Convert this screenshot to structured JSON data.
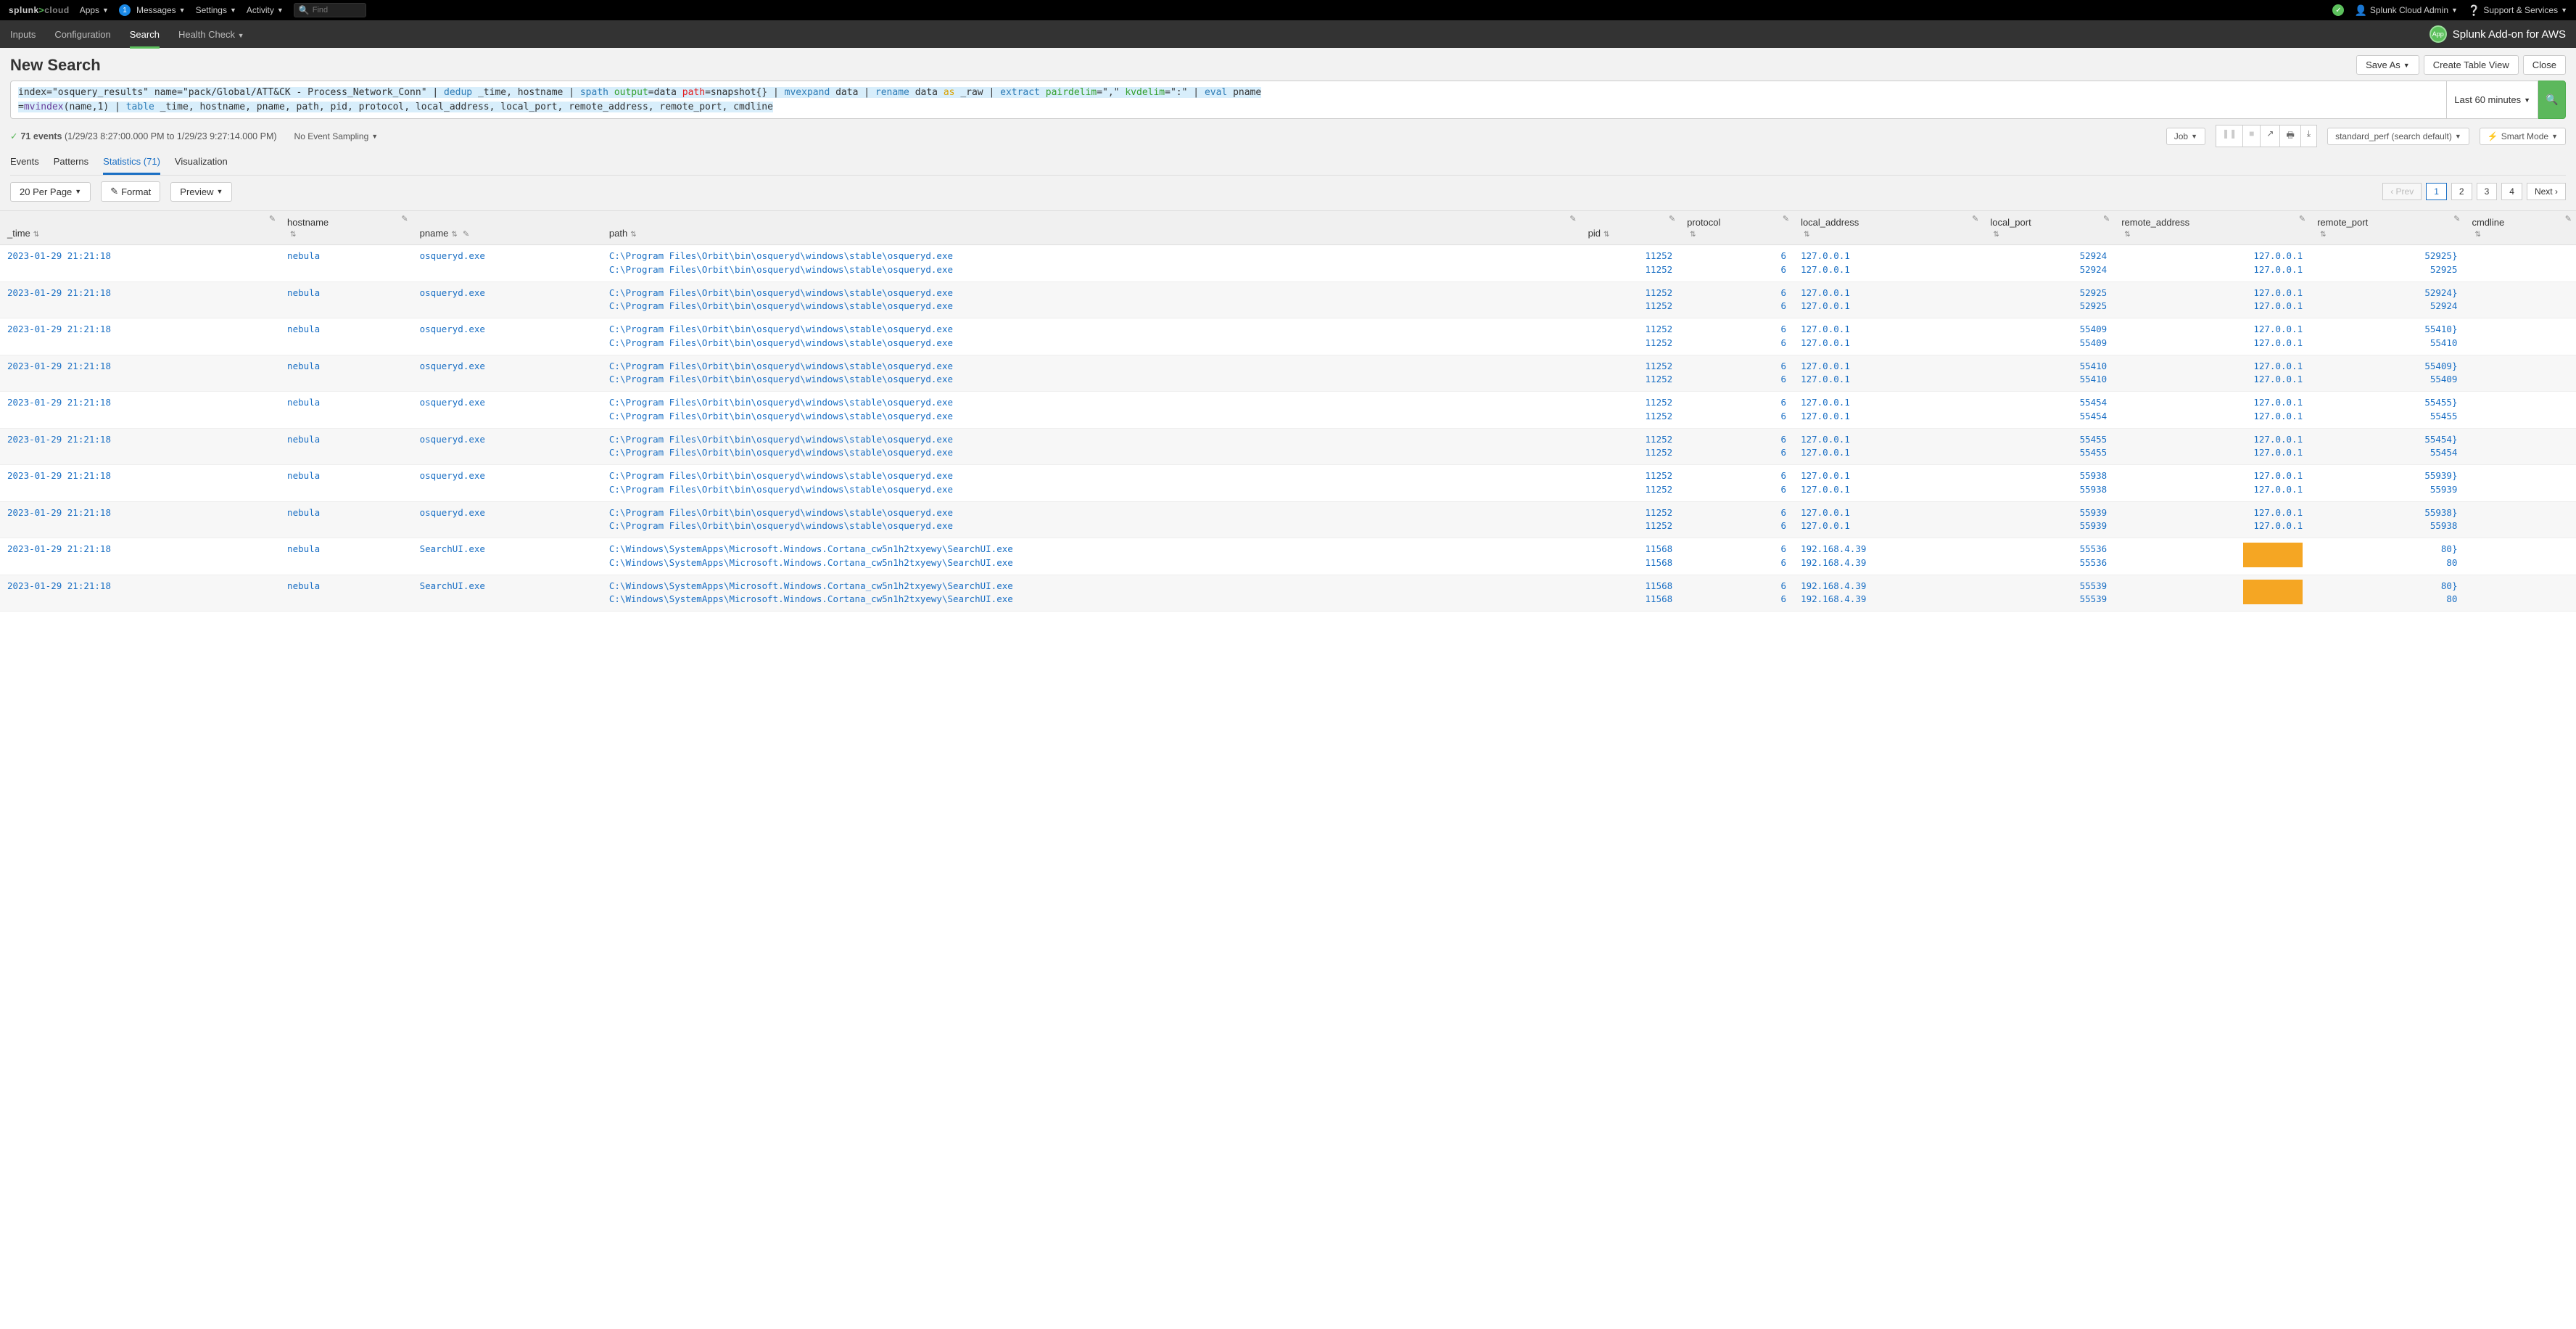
{
  "topbar": {
    "brand_prefix": "splunk",
    "brand_suffix": "cloud",
    "apps": "Apps",
    "messages": "Messages",
    "messages_badge": "1",
    "settings": "Settings",
    "activity": "Activity",
    "find_placeholder": "Find",
    "user": "Splunk Cloud Admin",
    "support": "Support & Services"
  },
  "secondbar": {
    "inputs": "Inputs",
    "configuration": "Configuration",
    "search": "Search",
    "healthcheck": "Health Check",
    "appbadge": "App",
    "appname": "Splunk Add-on for AWS"
  },
  "title": "New Search",
  "buttons": {
    "saveas": "Save As",
    "create_table": "Create Table View",
    "close": "Close",
    "timepicker": "Last 60 minutes",
    "perpage": "20 Per Page",
    "format": "Format",
    "preview": "Preview"
  },
  "spl": {
    "l1a": "index=\"osquery_results\" name=\"pack/Global/ATT&CK - Process_Network_Conn\" | ",
    "dedup": "dedup",
    "l1b": " _time, hostname | ",
    "spath": "spath",
    "output": " output",
    "l1c": "=data ",
    "path": "path",
    "l1d": "=snapshot{} | ",
    "mvexpand": "mvexpand",
    "l1e": " data | ",
    "rename": "rename",
    "l1f": " data ",
    "as": "as",
    "l1g": " _raw | ",
    "extract": "extract",
    "pairdelim": " pairdelim",
    "l1h": "=\",\" ",
    "kvdelim": "kvdelim",
    "l1i": "=\":\" | ",
    "eval": "eval",
    "l1j": " pname",
    "l2a": "    =",
    "mvindex": "mvindex",
    "l2b": "(name,1) | ",
    "table": "table",
    "l2c": " _time, hostname, pname, path, pid, protocol, local_address, local_port, remote_address, remote_port, cmdline"
  },
  "status": {
    "events": "71 events",
    "range": "(1/29/23 8:27:00.000 PM to 1/29/23 9:27:14.000 PM)",
    "sampling": "No Event Sampling",
    "job": "Job",
    "mode": "standard_perf (search default)",
    "smart": "Smart Mode"
  },
  "tabs": {
    "events": "Events",
    "patterns": "Patterns",
    "stats": "Statistics (71)",
    "viz": "Visualization"
  },
  "pager": {
    "prev": "Prev",
    "next": "Next",
    "p1": "1",
    "p2": "2",
    "p3": "3",
    "p4": "4"
  },
  "cols": {
    "time": "_time",
    "hostname": "hostname",
    "pname": "pname",
    "path": "path",
    "pid": "pid",
    "protocol": "protocol",
    "local_address": "local_address",
    "local_port": "local_port",
    "remote_address": "remote_address",
    "remote_port": "remote_port",
    "cmdline": "cmdline"
  },
  "rows": [
    {
      "time": "2023-01-29 21:21:18",
      "host": "nebula",
      "pname": "osqueryd.exe",
      "path": [
        "C:\\Program Files\\Orbit\\bin\\osqueryd\\windows\\stable\\osqueryd.exe",
        "C:\\Program Files\\Orbit\\bin\\osqueryd\\windows\\stable\\osqueryd.exe"
      ],
      "pid": [
        "11252",
        "11252"
      ],
      "proto": [
        "6",
        "6"
      ],
      "laddr": [
        "127.0.0.1",
        "127.0.0.1"
      ],
      "lport": [
        "52924",
        "52924"
      ],
      "raddr": [
        "127.0.0.1",
        "127.0.0.1"
      ],
      "rport": [
        "52925}",
        "52925"
      ]
    },
    {
      "time": "2023-01-29 21:21:18",
      "host": "nebula",
      "pname": "osqueryd.exe",
      "path": [
        "C:\\Program Files\\Orbit\\bin\\osqueryd\\windows\\stable\\osqueryd.exe",
        "C:\\Program Files\\Orbit\\bin\\osqueryd\\windows\\stable\\osqueryd.exe"
      ],
      "pid": [
        "11252",
        "11252"
      ],
      "proto": [
        "6",
        "6"
      ],
      "laddr": [
        "127.0.0.1",
        "127.0.0.1"
      ],
      "lport": [
        "52925",
        "52925"
      ],
      "raddr": [
        "127.0.0.1",
        "127.0.0.1"
      ],
      "rport": [
        "52924}",
        "52924"
      ]
    },
    {
      "time": "2023-01-29 21:21:18",
      "host": "nebula",
      "pname": "osqueryd.exe",
      "path": [
        "C:\\Program Files\\Orbit\\bin\\osqueryd\\windows\\stable\\osqueryd.exe",
        "C:\\Program Files\\Orbit\\bin\\osqueryd\\windows\\stable\\osqueryd.exe"
      ],
      "pid": [
        "11252",
        "11252"
      ],
      "proto": [
        "6",
        "6"
      ],
      "laddr": [
        "127.0.0.1",
        "127.0.0.1"
      ],
      "lport": [
        "55409",
        "55409"
      ],
      "raddr": [
        "127.0.0.1",
        "127.0.0.1"
      ],
      "rport": [
        "55410}",
        "55410"
      ]
    },
    {
      "time": "2023-01-29 21:21:18",
      "host": "nebula",
      "pname": "osqueryd.exe",
      "path": [
        "C:\\Program Files\\Orbit\\bin\\osqueryd\\windows\\stable\\osqueryd.exe",
        "C:\\Program Files\\Orbit\\bin\\osqueryd\\windows\\stable\\osqueryd.exe"
      ],
      "pid": [
        "11252",
        "11252"
      ],
      "proto": [
        "6",
        "6"
      ],
      "laddr": [
        "127.0.0.1",
        "127.0.0.1"
      ],
      "lport": [
        "55410",
        "55410"
      ],
      "raddr": [
        "127.0.0.1",
        "127.0.0.1"
      ],
      "rport": [
        "55409}",
        "55409"
      ]
    },
    {
      "time": "2023-01-29 21:21:18",
      "host": "nebula",
      "pname": "osqueryd.exe",
      "path": [
        "C:\\Program Files\\Orbit\\bin\\osqueryd\\windows\\stable\\osqueryd.exe",
        "C:\\Program Files\\Orbit\\bin\\osqueryd\\windows\\stable\\osqueryd.exe"
      ],
      "pid": [
        "11252",
        "11252"
      ],
      "proto": [
        "6",
        "6"
      ],
      "laddr": [
        "127.0.0.1",
        "127.0.0.1"
      ],
      "lport": [
        "55454",
        "55454"
      ],
      "raddr": [
        "127.0.0.1",
        "127.0.0.1"
      ],
      "rport": [
        "55455}",
        "55455"
      ]
    },
    {
      "time": "2023-01-29 21:21:18",
      "host": "nebula",
      "pname": "osqueryd.exe",
      "path": [
        "C:\\Program Files\\Orbit\\bin\\osqueryd\\windows\\stable\\osqueryd.exe",
        "C:\\Program Files\\Orbit\\bin\\osqueryd\\windows\\stable\\osqueryd.exe"
      ],
      "pid": [
        "11252",
        "11252"
      ],
      "proto": [
        "6",
        "6"
      ],
      "laddr": [
        "127.0.0.1",
        "127.0.0.1"
      ],
      "lport": [
        "55455",
        "55455"
      ],
      "raddr": [
        "127.0.0.1",
        "127.0.0.1"
      ],
      "rport": [
        "55454}",
        "55454"
      ]
    },
    {
      "time": "2023-01-29 21:21:18",
      "host": "nebula",
      "pname": "osqueryd.exe",
      "path": [
        "C:\\Program Files\\Orbit\\bin\\osqueryd\\windows\\stable\\osqueryd.exe",
        "C:\\Program Files\\Orbit\\bin\\osqueryd\\windows\\stable\\osqueryd.exe"
      ],
      "pid": [
        "11252",
        "11252"
      ],
      "proto": [
        "6",
        "6"
      ],
      "laddr": [
        "127.0.0.1",
        "127.0.0.1"
      ],
      "lport": [
        "55938",
        "55938"
      ],
      "raddr": [
        "127.0.0.1",
        "127.0.0.1"
      ],
      "rport": [
        "55939}",
        "55939"
      ]
    },
    {
      "time": "2023-01-29 21:21:18",
      "host": "nebula",
      "pname": "osqueryd.exe",
      "path": [
        "C:\\Program Files\\Orbit\\bin\\osqueryd\\windows\\stable\\osqueryd.exe",
        "C:\\Program Files\\Orbit\\bin\\osqueryd\\windows\\stable\\osqueryd.exe"
      ],
      "pid": [
        "11252",
        "11252"
      ],
      "proto": [
        "6",
        "6"
      ],
      "laddr": [
        "127.0.0.1",
        "127.0.0.1"
      ],
      "lport": [
        "55939",
        "55939"
      ],
      "raddr": [
        "127.0.0.1",
        "127.0.0.1"
      ],
      "rport": [
        "55938}",
        "55938"
      ]
    },
    {
      "time": "2023-01-29 21:21:18",
      "host": "nebula",
      "pname": "SearchUI.exe",
      "path": [
        "C:\\Windows\\SystemApps\\Microsoft.Windows.Cortana_cw5n1h2txyewy\\SearchUI.exe",
        "C:\\Windows\\SystemApps\\Microsoft.Windows.Cortana_cw5n1h2txyewy\\SearchUI.exe"
      ],
      "pid": [
        "11568",
        "11568"
      ],
      "proto": [
        "6",
        "6"
      ],
      "laddr": [
        "192.168.4.39",
        "192.168.4.39"
      ],
      "lport": [
        "55536",
        "55536"
      ],
      "raddr": [
        "",
        ""
      ],
      "rport": [
        "80}",
        "80"
      ],
      "redact_raddr": true
    },
    {
      "time": "2023-01-29 21:21:18",
      "host": "nebula",
      "pname": "SearchUI.exe",
      "path": [
        "C:\\Windows\\SystemApps\\Microsoft.Windows.Cortana_cw5n1h2txyewy\\SearchUI.exe",
        "C:\\Windows\\SystemApps\\Microsoft.Windows.Cortana_cw5n1h2txyewy\\SearchUI.exe"
      ],
      "pid": [
        "11568",
        "11568"
      ],
      "proto": [
        "6",
        "6"
      ],
      "laddr": [
        "192.168.4.39",
        "192.168.4.39"
      ],
      "lport": [
        "55539",
        "55539"
      ],
      "raddr": [
        "",
        ""
      ],
      "rport": [
        "80}",
        "80"
      ],
      "redact_raddr": true
    }
  ]
}
